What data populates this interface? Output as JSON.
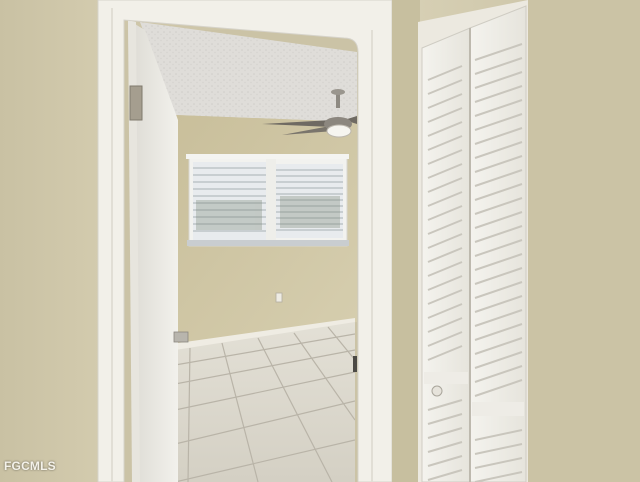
{
  "watermark": {
    "text": "FGCMLS"
  },
  "palette": {
    "hall_wall_left": "#cdc5a8",
    "hall_wall_right": "#cfc8ab",
    "door_trim": "#f3f1ea",
    "room_wall": "#cfc6a3",
    "ceiling": "#dedcd8",
    "floor_tile": "#dcd9cf",
    "grout": "#b7b2a6",
    "closet_door": "#f0eee8",
    "window_blind": "#e6e9ec"
  },
  "scene": {
    "objects": [
      "hallway",
      "doorway",
      "bedroom",
      "window-with-blinds",
      "ceiling-fan",
      "tile-floor",
      "louvered-closet-door",
      "door-hinge",
      "wall-outlet"
    ]
  }
}
